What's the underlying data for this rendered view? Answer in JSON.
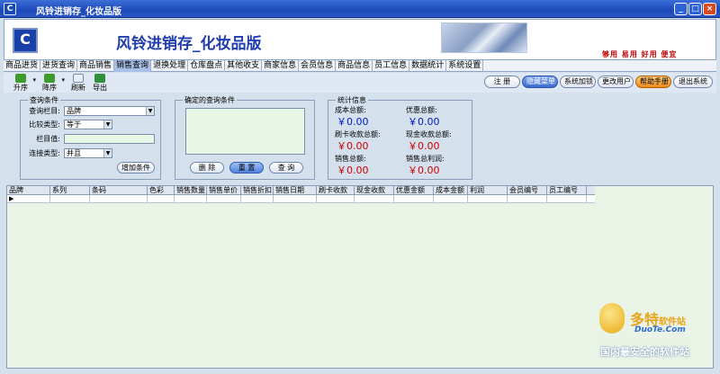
{
  "window": {
    "title": "风铃进销存_化妆品版",
    "min": "_",
    "max": "□",
    "close": "×"
  },
  "banner": {
    "logo_glyph": "C",
    "app_title": "风铃进销存_化妆品版",
    "slogan": "够用 易用 好用 便宜"
  },
  "menu": {
    "items": [
      "商品进货",
      "进货查询",
      "商品销售",
      "销售查询",
      "退换处理",
      "仓库盘点",
      "其他收支",
      "商家信息",
      "会员信息",
      "商品信息",
      "员工信息",
      "数据统计",
      "系统设置"
    ],
    "active": "销售查询"
  },
  "toolbar": {
    "left": [
      {
        "label": "升序",
        "icon": "sort-ascending-icon"
      },
      {
        "label": "降序",
        "icon": "sort-descending-icon"
      },
      {
        "label": "刷新",
        "icon": "refresh-icon"
      },
      {
        "label": "导出",
        "icon": "export-icon"
      }
    ],
    "right": [
      "注 册",
      "隐藏菜单",
      "系统加锁",
      "更改用户",
      "帮助手册",
      "退出系统"
    ]
  },
  "query_panel": {
    "legend": "查询条件",
    "field_label": "查询栏目:",
    "field_value": "品牌",
    "compare_label": "比较类型:",
    "compare_value": "等于",
    "value_label": "栏目值:",
    "value_value": "",
    "join_label": "连接类型:",
    "join_value": "并且",
    "add_button": "增加条件"
  },
  "confirmed_panel": {
    "legend": "确定的查询条件",
    "delete_button": "删 除",
    "reset_button": "重 置",
    "query_button": "查 询"
  },
  "stats_panel": {
    "legend": "统计信息",
    "items": [
      {
        "label": "成本总额:",
        "value": "￥0.00",
        "color": "#0018c8"
      },
      {
        "label": "优惠总额:",
        "value": "￥0.00",
        "color": "#0018c8"
      },
      {
        "label": "刷卡收款总额:",
        "value": "￥0.00",
        "color": "#d00000"
      },
      {
        "label": "现金收款总额:",
        "value": "￥0.00",
        "color": "#d00000"
      },
      {
        "label": "销售总额:",
        "value": "￥0.00",
        "color": "#d00000"
      },
      {
        "label": "销售总利润:",
        "value": "￥0.00",
        "color": "#d00000"
      }
    ]
  },
  "grid": {
    "columns": [
      "品牌",
      "系列",
      "条码",
      "色彩",
      "销售数量",
      "销售单价",
      "销售折扣",
      "销售日期",
      "刷卡收款",
      "现金收款",
      "优惠金额",
      "成本金额",
      "利润",
      "会员编号",
      "员工编号"
    ],
    "row_indicator": "▶"
  },
  "watermark": {
    "brand": "多特",
    "brand_suffix": "软件站",
    "domain": "DuoTe.Com",
    "tagline": "国内最安全的软件站"
  }
}
